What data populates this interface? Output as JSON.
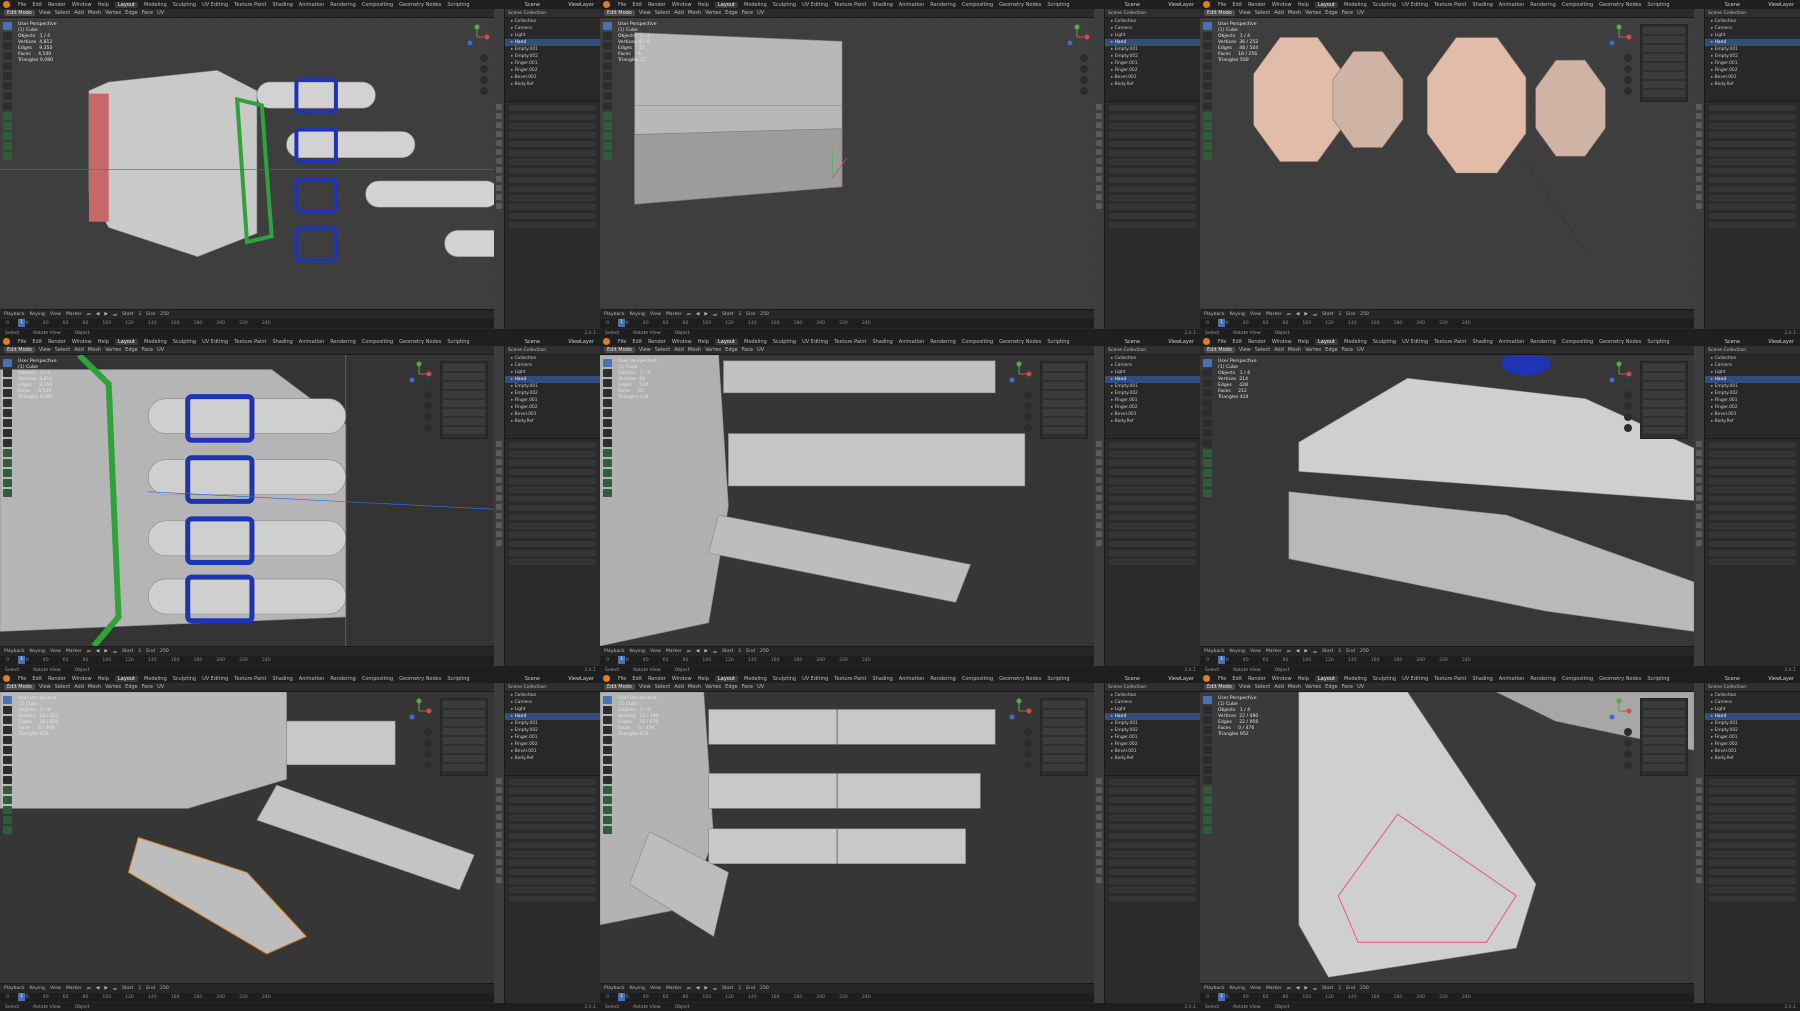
{
  "app": {
    "menu": [
      "File",
      "Edit",
      "Render",
      "Window",
      "Help"
    ],
    "workspaces": [
      "Layout",
      "Modeling",
      "Sculpting",
      "UV Editing",
      "Texture Paint",
      "Shading",
      "Animation",
      "Rendering",
      "Compositing",
      "Geometry Nodes",
      "Scripting"
    ],
    "active_workspace": "Layout",
    "scene": "Scene",
    "view_layer": "ViewLayer"
  },
  "viewport": {
    "mode": "Edit Mode",
    "header_items": [
      "View",
      "Select",
      "Add",
      "Mesh",
      "Vertex",
      "Edge",
      "Face",
      "UV"
    ],
    "perspective_label": "User Perspective",
    "object_label": "(1) Cube"
  },
  "outliner": {
    "header": "Scene Collection",
    "items": [
      "Collection",
      "Camera",
      "Light",
      "Hand",
      "Empty.001",
      "Empty.002",
      "Finger.001",
      "Finger.002",
      "Bevel.001",
      "Body.Ref"
    ]
  },
  "timeline": {
    "controls": [
      "Playback",
      "Keying",
      "View",
      "Marker"
    ],
    "start_label": "Start",
    "start": "1",
    "end_label": "End",
    "end": "250",
    "frame": "1",
    "ruler": [
      "0",
      "20",
      "40",
      "60",
      "80",
      "100",
      "120",
      "140",
      "160",
      "180",
      "200",
      "220",
      "240"
    ]
  },
  "statusbar": {
    "items": [
      "Select",
      "Rotate View",
      "Object"
    ],
    "version": "3.4.1"
  },
  "panes": [
    {
      "id": "hand-overview",
      "stats": "Objects   1 / 4\nVertices  4,812\nEdges     9,350\nFaces     4,540\nTriangles 9,080",
      "selected_outliner": 3
    },
    {
      "id": "palm-block",
      "stats": "Objects   1 / 4\nVertices  8 / 8\nEdges     12\nFaces     6\nTriangles 12",
      "selected_outliner": 3
    },
    {
      "id": "finger-cylinders",
      "stats": "Objects   1 / 4\nVertices  36 / 252\nEdges     48 / 504\nFaces     18 / 256\nTriangles 500",
      "selected_outliner": 3
    },
    {
      "id": "hand-closeup",
      "stats": "Objects   1 / 4\nVertices  4,812\nEdges     9,350\nFaces     4,540\nTriangles 9,080",
      "selected_outliner": 3
    },
    {
      "id": "finger-blocks",
      "stats": "Objects   1 / 4\nVertices  64\nEdges     124\nFaces     62\nTriangles 124",
      "selected_outliner": 3
    },
    {
      "id": "finger-side",
      "stats": "Objects   1 / 4\nVertices  214\nEdges     428\nFaces     212\nTriangles 424",
      "selected_outliner": 3
    },
    {
      "id": "thumb-bevel",
      "stats": "Objects   1 / 4\nVertices  18 / 312\nEdges     24 / 620\nFaces     8 / 306\nTriangles 612",
      "selected_outliner": 3
    },
    {
      "id": "finger-loops",
      "stats": "Objects   1 / 4\nVertices  16 / 340\nEdges     16 / 676\nFaces     0 / 336\nTriangles 672",
      "selected_outliner": 3
    },
    {
      "id": "fingertip",
      "stats": "Objects   1 / 4\nVertices  22 / 480\nEdges     22 / 956\nFaces     0 / 476\nTriangles 952",
      "selected_outliner": 3
    }
  ]
}
